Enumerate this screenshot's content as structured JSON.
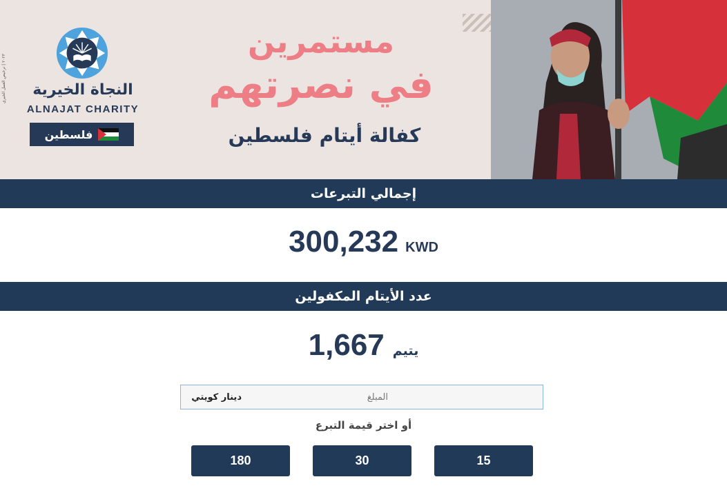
{
  "banner": {
    "side_text": "٢٠٢٣ | ترخيص العمل الخيري",
    "brand_ar": "النجاة الخيرية",
    "brand_en": "ALNAJAT CHARITY",
    "country_tag": "فلسطين",
    "headline_line1": "مستمرين",
    "headline_line2": "في نصرتهم",
    "sub_headline": "كفالة أيتام فلسطين",
    "colors": {
      "navy": "#263a58",
      "pink": "#ee7e86",
      "badge_blue": "#4fa3dc",
      "flag_red": "#d6303b",
      "flag_green": "#1e8a3a"
    }
  },
  "total_donations": {
    "label": "إجمالي التبرعات",
    "value": "300,232",
    "currency": "KWD"
  },
  "sponsored_orphans": {
    "label": "عدد الأيتام المكفولين",
    "value": "1,667",
    "unit": "يتيم"
  },
  "donation_form": {
    "amount_placeholder": "المبلغ",
    "currency_label": "دينار كويتي",
    "choose_label": "أو اختر قيمة التبرع",
    "preset_amounts": [
      "15",
      "30",
      "180"
    ]
  },
  "icons": {
    "logo": "book-sunburst-badge-icon",
    "flag": "palestine-flag-icon"
  }
}
